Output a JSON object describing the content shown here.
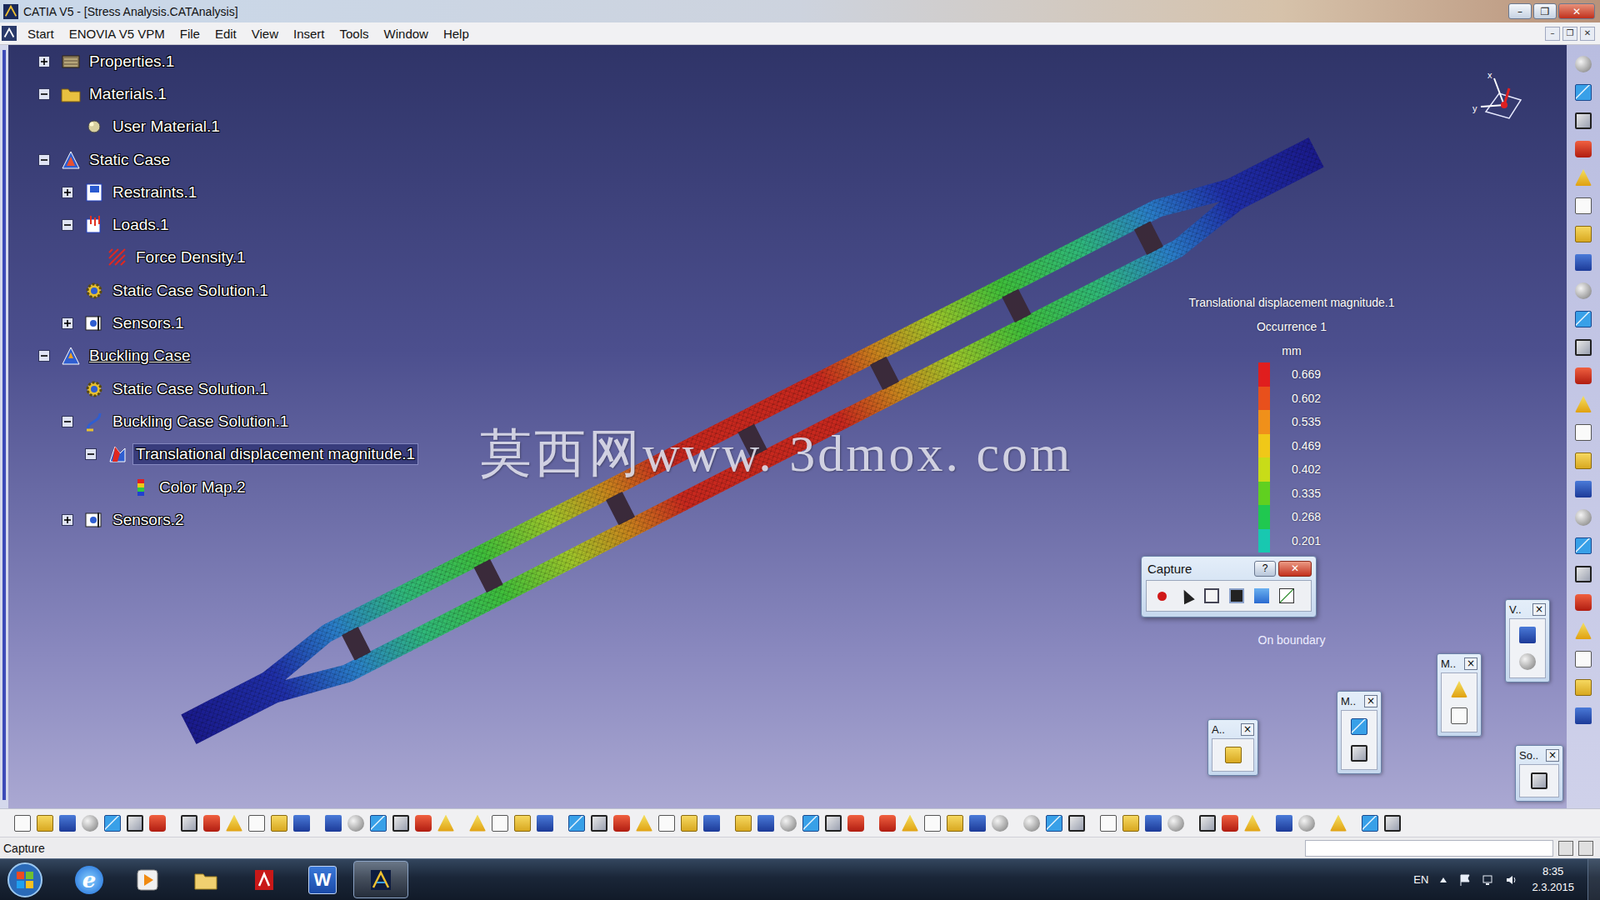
{
  "window": {
    "title": "CATIA V5 - [Stress Analysis.CATAnalysis]",
    "controls": [
      "–",
      "❐",
      "✕"
    ]
  },
  "menu": {
    "items": [
      "Start",
      "ENOVIA V5 VPM",
      "File",
      "Edit",
      "View",
      "Insert",
      "Tools",
      "Window",
      "Help"
    ],
    "document_controls": [
      "–",
      "❐",
      "✕"
    ]
  },
  "tree": [
    {
      "label": "Properties.1",
      "level": 0,
      "icon": "properties",
      "expandable": true,
      "expanded": false,
      "selected": false,
      "current": false
    },
    {
      "label": "Materials.1",
      "level": 0,
      "icon": "folder",
      "expandable": true,
      "expanded": true,
      "selected": false,
      "current": false
    },
    {
      "label": "User Material.1",
      "level": 1,
      "icon": "material",
      "expandable": false,
      "expanded": false,
      "selected": false,
      "current": false
    },
    {
      "label": "Static Case",
      "level": 0,
      "icon": "case",
      "expandable": true,
      "expanded": true,
      "selected": false,
      "current": false
    },
    {
      "label": "Restraints.1",
      "level": 1,
      "icon": "restraint",
      "expandable": true,
      "expanded": false,
      "selected": false,
      "current": false
    },
    {
      "label": "Loads.1",
      "level": 1,
      "icon": "loads",
      "expandable": true,
      "expanded": true,
      "selected": false,
      "current": false
    },
    {
      "label": "Force Density.1",
      "level": 2,
      "icon": "force",
      "expandable": false,
      "expanded": false,
      "selected": false,
      "current": false
    },
    {
      "label": "Static Case Solution.1",
      "level": 1,
      "icon": "solution",
      "expandable": false,
      "expanded": false,
      "selected": false,
      "current": false
    },
    {
      "label": "Sensors.1",
      "level": 1,
      "icon": "sensors",
      "expandable": true,
      "expanded": false,
      "selected": false,
      "current": false
    },
    {
      "label": "Buckling Case",
      "level": 0,
      "icon": "buckling",
      "expandable": true,
      "expanded": true,
      "selected": false,
      "current": true
    },
    {
      "label": "Static Case Solution.1",
      "level": 1,
      "icon": "solution",
      "expandable": false,
      "expanded": false,
      "selected": false,
      "current": false
    },
    {
      "label": "Buckling Case Solution.1",
      "level": 1,
      "icon": "buckling-solution",
      "expandable": true,
      "expanded": true,
      "selected": false,
      "current": false
    },
    {
      "label": "Translational displacement magnitude.1",
      "level": 2,
      "icon": "image",
      "expandable": true,
      "expanded": true,
      "selected": true,
      "current": false
    },
    {
      "label": "Color Map.2",
      "level": 3,
      "icon": "colormap",
      "expandable": false,
      "expanded": false,
      "selected": false,
      "current": false
    },
    {
      "label": "Sensors.2",
      "level": 1,
      "icon": "sensors",
      "expandable": true,
      "expanded": false,
      "selected": false,
      "current": false
    }
  ],
  "watermark": "莫西网www. 3dmox. com",
  "compass": {
    "x_label": "x",
    "y_label": "y"
  },
  "legend": {
    "title": "Translational displacement magnitude.1",
    "occurrence": "Occurrence 1",
    "unit": "mm",
    "levels": [
      {
        "value": "0.669",
        "color": "#e01e1e"
      },
      {
        "value": "0.602",
        "color": "#e8501c"
      },
      {
        "value": "0.535",
        "color": "#f0901a"
      },
      {
        "value": "0.469",
        "color": "#f0c818"
      },
      {
        "value": "0.402",
        "color": "#c8dc18"
      },
      {
        "value": "0.335",
        "color": "#60d020"
      },
      {
        "value": "0.268",
        "color": "#20c850"
      },
      {
        "value": "0.201",
        "color": "#18c8b0"
      }
    ],
    "footer": "On boundary"
  },
  "capture_toolbar": {
    "title": "Capture",
    "help": "?",
    "close": "✕"
  },
  "floating_toolbars": [
    {
      "title": "A..",
      "close": "×"
    },
    {
      "title": "M..",
      "close": "×"
    },
    {
      "title": "M..",
      "close": "×"
    },
    {
      "title": "V..",
      "close": "×"
    },
    {
      "title": "So..",
      "close": "×"
    }
  ],
  "status_bar": {
    "text": "Capture"
  },
  "taskbar": {
    "apps": [
      {
        "kind": "ie",
        "label": "e",
        "selected": false
      },
      {
        "kind": "media",
        "label": "",
        "selected": false
      },
      {
        "kind": "explorer",
        "label": "",
        "selected": false
      },
      {
        "kind": "acrobat",
        "label": "",
        "selected": false
      },
      {
        "kind": "word",
        "label": "W",
        "selected": false
      },
      {
        "kind": "catia",
        "label": "",
        "selected": true
      }
    ],
    "language": "EN",
    "time": "8:35",
    "date": "2.3.2015"
  }
}
